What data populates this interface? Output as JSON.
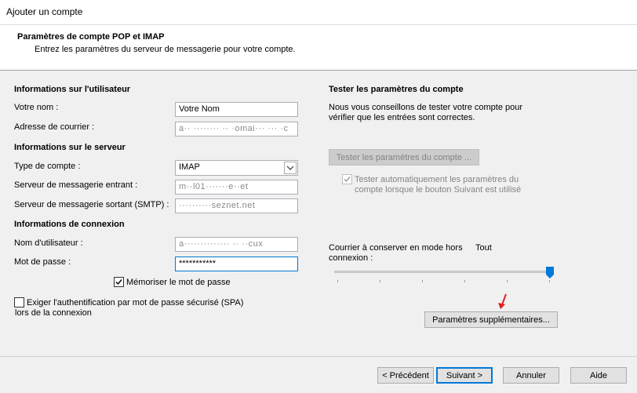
{
  "window": {
    "title": "Ajouter un compte"
  },
  "header": {
    "title": "Paramètres de compte POP et IMAP",
    "subtitle": "Entrez les paramètres du serveur de messagerie pour votre compte."
  },
  "user_info": {
    "heading": "Informations sur l'utilisateur",
    "name_label": "Votre nom :",
    "name_value": "Votre Nom",
    "email_label": "Adresse de courrier :",
    "email_value": "a·· ········ ·· ·omai··· ··· ·c"
  },
  "server_info": {
    "heading": "Informations sur le serveur",
    "account_type_label": "Type de compte :",
    "account_type_value": "IMAP",
    "incoming_label": "Serveur de messagerie entrant :",
    "incoming_value": "m··l01·······e··et",
    "outgoing_label": "Serveur de messagerie sortant (SMTP) :",
    "outgoing_value": "··········seznet.net"
  },
  "login_info": {
    "heading": "Informations de connexion",
    "username_label": "Nom d'utilisateur :",
    "username_value": "a·············· ·· ··cux",
    "password_label": "Mot de passe :",
    "password_value": "***********",
    "remember_label": "Mémoriser le mot de passe",
    "spa_label_line1": "Exiger l'authentification par mot de passe sécurisé (SPA)",
    "spa_label_line2": "lors de la connexion"
  },
  "test": {
    "heading": "Tester les paramètres du compte",
    "desc_line1": "Nous vous conseillons de tester votre compte pour",
    "desc_line2": "vérifier que les entrées sont correctes.",
    "button": "Tester les paramètres du compte ...",
    "auto_line1": "Tester automatiquement les paramètres du",
    "auto_line2": "compte lorsque le bouton Suivant est utilisé"
  },
  "offline": {
    "label_line1": "Courrier à conserver en mode hors",
    "label_line2": "connexion :",
    "value": "Tout",
    "slider_fraction": 1.0
  },
  "more_settings_button": "Paramètres supplémentaires...",
  "footer": {
    "back": "< Précédent",
    "next": "Suivant >",
    "cancel": "Annuler",
    "help": "Aide"
  },
  "colors": {
    "accent": "#0078d7",
    "annotation_arrow": "#e02020",
    "disabled": "#838383"
  },
  "icons": {
    "dropdown": "chevron-down-icon",
    "check": "checkmark-icon",
    "slider": "slider-thumb-icon",
    "annotation": "red-arrow-icon"
  }
}
